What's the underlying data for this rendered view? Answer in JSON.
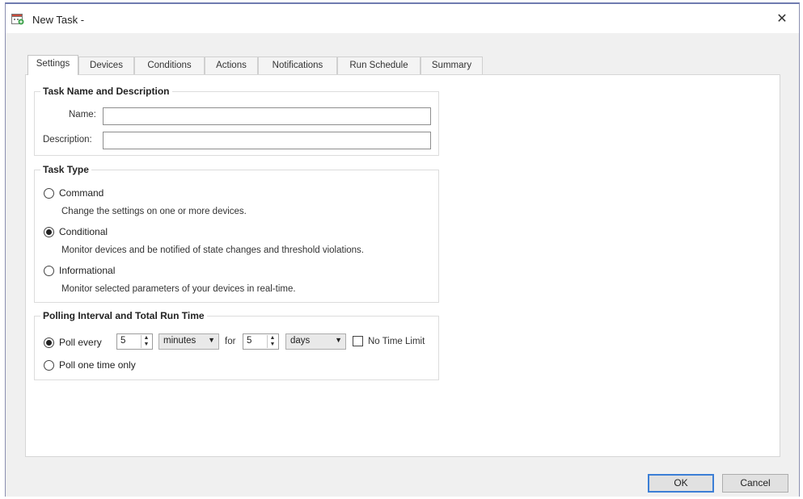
{
  "window": {
    "title": "New Task -",
    "close_glyph": "✕"
  },
  "tabs": [
    {
      "label": "Settings",
      "active": true
    },
    {
      "label": "Devices",
      "active": false
    },
    {
      "label": "Conditions",
      "active": false
    },
    {
      "label": "Actions",
      "active": false
    },
    {
      "label": "Notifications",
      "active": false
    },
    {
      "label": "Run Schedule",
      "active": false
    },
    {
      "label": "Summary",
      "active": false
    }
  ],
  "name_group": {
    "title": "Task Name and Description",
    "name_label": "Name:",
    "name_value": "",
    "description_label": "Description:",
    "description_value": ""
  },
  "task_type": {
    "title": "Task Type",
    "options": [
      {
        "label": "Command",
        "description": "Change the settings on one or more devices.",
        "selected": false
      },
      {
        "label": "Conditional",
        "description": "Monitor devices and be notified of state changes and threshold violations.",
        "selected": true
      },
      {
        "label": "Informational",
        "description": "Monitor selected parameters of your devices in real-time.",
        "selected": false
      }
    ]
  },
  "polling": {
    "title": "Polling Interval and Total Run Time",
    "poll_every_label": "Poll every",
    "poll_every_selected": true,
    "interval_value": "5",
    "interval_unit": "minutes",
    "for_label": "for",
    "duration_value": "5",
    "duration_unit": "days",
    "no_time_limit_label": "No Time Limit",
    "no_time_limit_checked": false,
    "poll_once_label": "Poll one time only",
    "poll_once_selected": false
  },
  "buttons": {
    "ok": "OK",
    "cancel": "Cancel"
  }
}
